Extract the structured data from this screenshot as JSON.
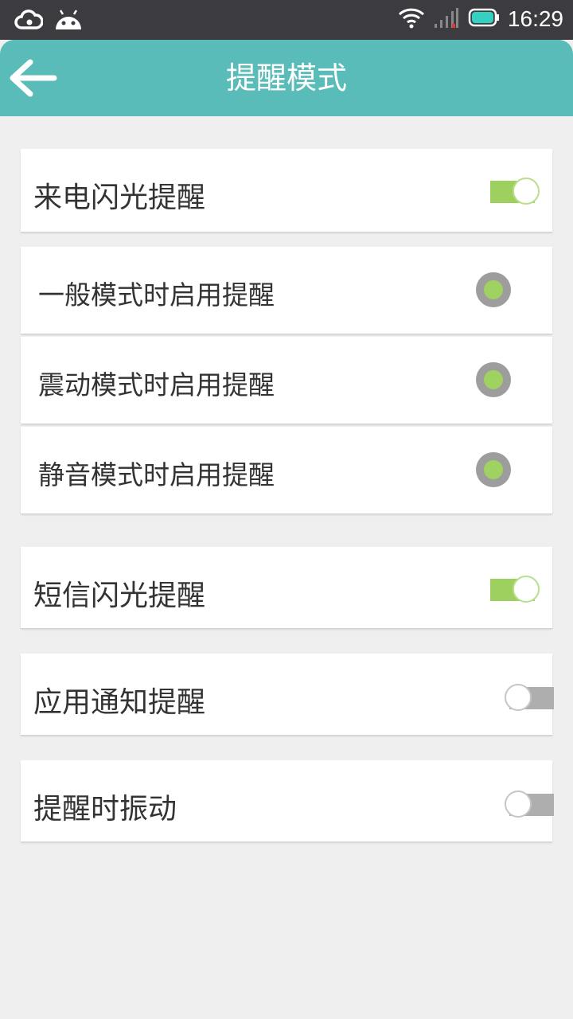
{
  "status_bar": {
    "time": "16:29",
    "icons": [
      "cloud-icon",
      "android-icon",
      "wifi-icon",
      "signal-icon",
      "battery-icon"
    ]
  },
  "header": {
    "title": "提醒模式",
    "back_icon": "arrow-left-icon"
  },
  "colors": {
    "header": "#59bcb8",
    "toggle_on": "#9ed060",
    "toggle_off": "#aeaeae",
    "radio_dot": "#9fd261"
  },
  "settings": {
    "call_flash": {
      "label": "来电闪光提醒",
      "enabled": true
    },
    "modes": [
      {
        "label": "一般模式时启用提醒",
        "selected": true
      },
      {
        "label": "震动模式时启用提醒",
        "selected": true
      },
      {
        "label": "静音模式时启用提醒",
        "selected": true
      }
    ],
    "sms_flash": {
      "label": "短信闪光提醒",
      "enabled": true
    },
    "app_notify": {
      "label": "应用通知提醒",
      "enabled": false
    },
    "vibrate": {
      "label": "提醒时振动",
      "enabled": false
    }
  }
}
